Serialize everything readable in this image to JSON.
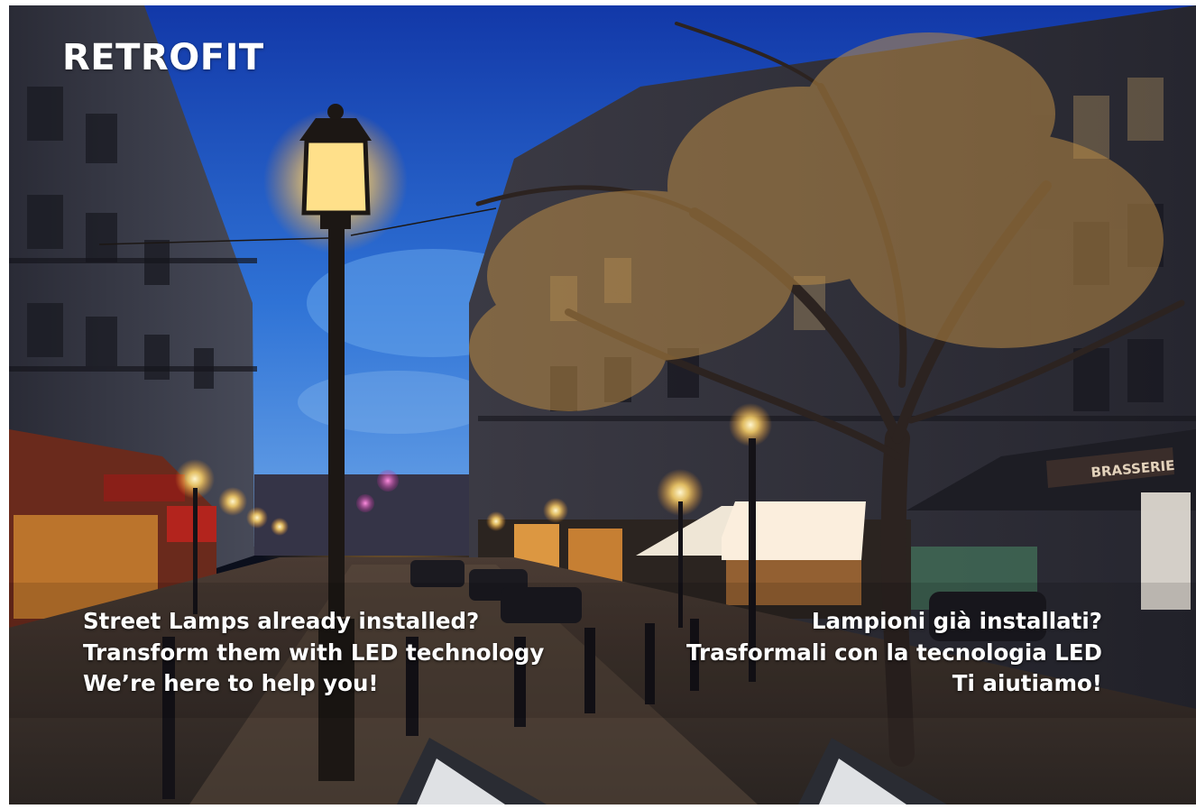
{
  "photo": {
    "subject": "Paris street at dusk with lit street lamps",
    "colors": {
      "sky_top": "#1646b8",
      "sky_bottom": "#3f8be0",
      "lamp_glow": "#ffd56a",
      "street": "#3a2f2a"
    }
  },
  "title": "RETROFIT",
  "caption_en": {
    "line1": "Street Lamps already installed?",
    "line2": "Transform them with LED technology",
    "line3": "We’re here to help you!"
  },
  "caption_it": {
    "line1": "Lampioni già installati?",
    "line2": "Trasformali con la tecnologia LED",
    "line3": "Ti aiutiamo!"
  },
  "shop_sign": "BRASSERIE"
}
